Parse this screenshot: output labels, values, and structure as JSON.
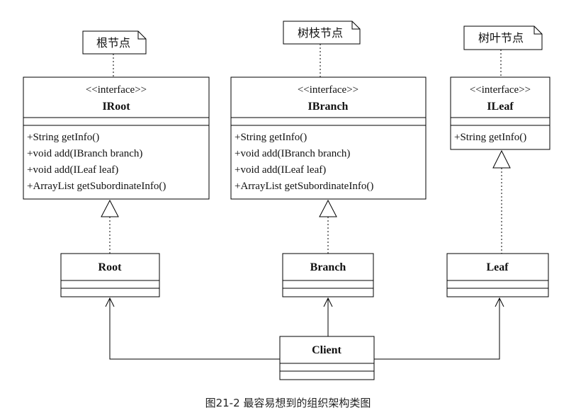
{
  "diagram": {
    "notes": [
      {
        "id": "note-root",
        "text": "根节点"
      },
      {
        "id": "note-branch",
        "text": "树枝节点"
      },
      {
        "id": "note-leaf",
        "text": "树叶节点"
      }
    ],
    "interfaces": [
      {
        "id": "iroot",
        "stereotype": "<<interface>>",
        "name": "IRoot",
        "methods": [
          "+String getInfo()",
          "+void add(IBranch branch)",
          "+void add(ILeaf leaf)",
          "+ArrayList getSubordinateInfo()"
        ]
      },
      {
        "id": "ibranch",
        "stereotype": "<<interface>>",
        "name": "IBranch",
        "methods": [
          "+String getInfo()",
          "+void add(IBranch branch)",
          "+void add(ILeaf leaf)",
          "+ArrayList getSubordinateInfo()"
        ]
      },
      {
        "id": "ileaf",
        "stereotype": "<<interface>>",
        "name": "ILeaf",
        "methods": [
          "+String getInfo()"
        ]
      }
    ],
    "classes": [
      {
        "id": "root",
        "name": "Root"
      },
      {
        "id": "branch",
        "name": "Branch"
      },
      {
        "id": "leaf",
        "name": "Leaf"
      },
      {
        "id": "client",
        "name": "Client"
      }
    ]
  },
  "caption": "图21-2 最容易想到的组织架构类图"
}
